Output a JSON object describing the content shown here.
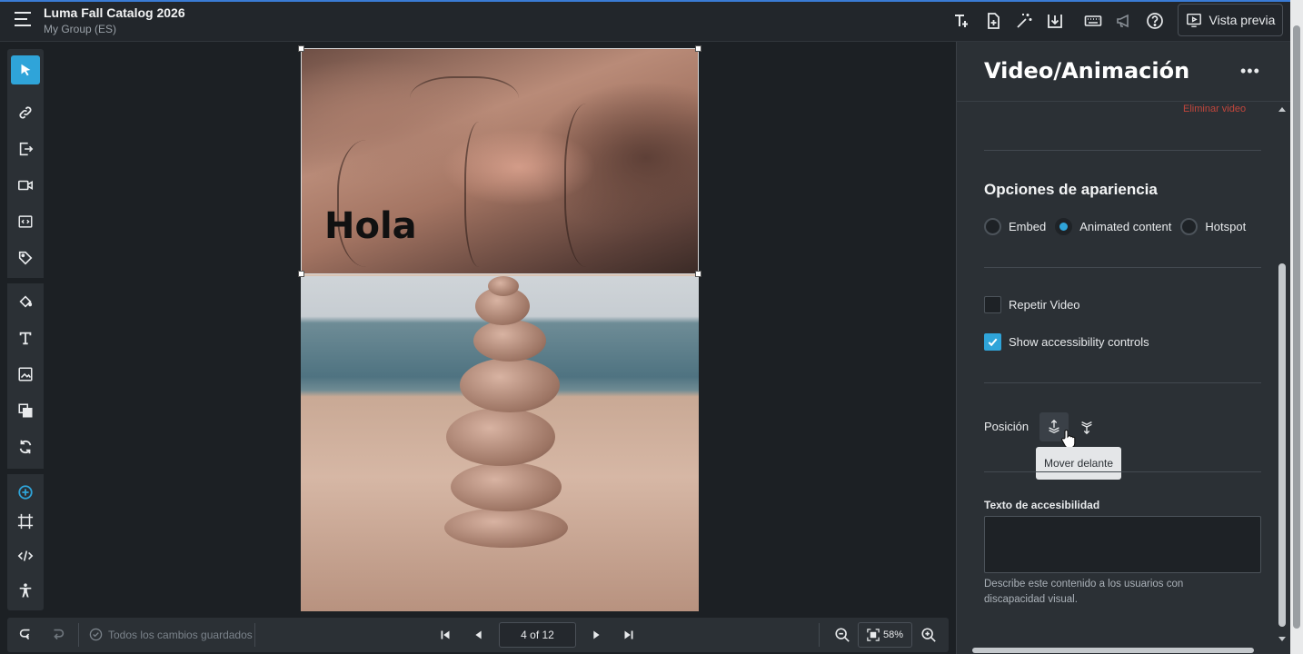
{
  "header": {
    "title": "Luma Fall Catalog 2026",
    "subtitle": "My Group (ES)",
    "preview_label": "Vista previa",
    "icons": [
      "text-format-icon",
      "document-add-icon",
      "magic-wand-icon",
      "download-icon",
      "keyboard-icon",
      "megaphone-icon",
      "help-icon"
    ]
  },
  "toolbar": {
    "tools": [
      "select-arrow-icon",
      "link-icon",
      "export-icon",
      "video-icon",
      "embed-code-icon",
      "tag-icon",
      "paint-bucket-icon",
      "text-icon",
      "image-icon",
      "layers-icon",
      "refresh-icon"
    ],
    "secondary_tools": [
      "add-circle-icon",
      "crop-frame-icon",
      "code-icon",
      "accessibility-icon"
    ]
  },
  "canvas": {
    "overlay_text": "Hola"
  },
  "bottombar": {
    "saved_status": "Todos los cambios guardados",
    "page_indicator": "4 of 12",
    "zoom": "58%"
  },
  "panel": {
    "title": "Video/Animación",
    "delete_link": "Eliminar video",
    "appearance_title": "Opciones de apariencia",
    "radio_options": [
      {
        "label": "Embed",
        "selected": false
      },
      {
        "label": "Animated content",
        "selected": true
      },
      {
        "label": "Hotspot",
        "selected": false
      }
    ],
    "repeat_label": "Repetir Video",
    "repeat_checked": false,
    "accessibility_label": "Show accessibility controls",
    "accessibility_checked": true,
    "position_label": "Posición",
    "tooltip": "Mover delante",
    "alt_text_label": "Texto de accesibilidad",
    "alt_text_value": "",
    "help_text": "Describe este contenido a los usuarios con discapacidad visual."
  },
  "colors": {
    "accent": "#2fa4d9",
    "danger": "#c0463c",
    "panel_bg": "#2b3035",
    "app_bg": "#1c2024"
  }
}
